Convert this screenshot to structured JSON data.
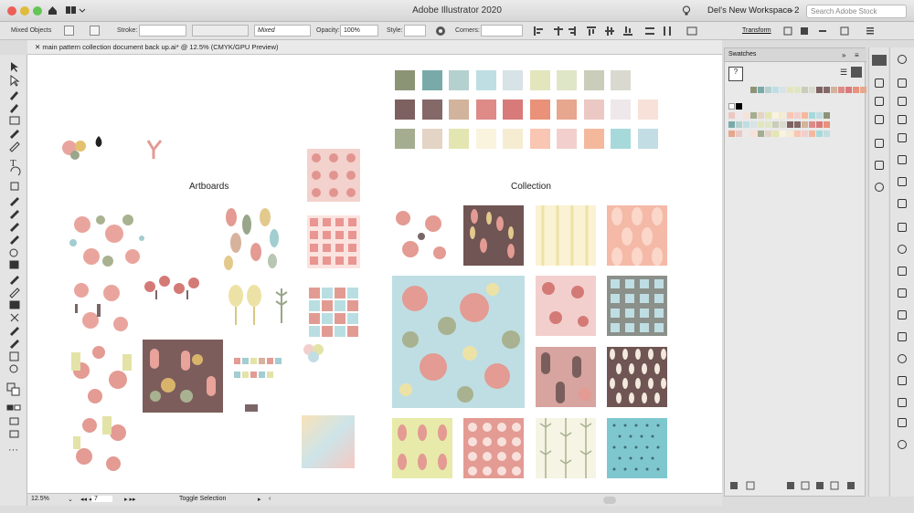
{
  "window": {
    "title": "Adobe Illustrator 2020",
    "workspace": "Del's New Workspace 2",
    "search_placeholder": "Search Adobe Stock"
  },
  "control": {
    "selection": "Mixed Objects",
    "stroke_label": "Stroke:",
    "brush": "Mixed",
    "opacity_label": "Opacity:",
    "opacity": "100%",
    "style_label": "Style:",
    "corners_label": "Corners:",
    "transform": "Transform"
  },
  "document": {
    "tab": "main pattern collection document back up.ai* @ 12.5% (CMYK/GPU Preview)"
  },
  "canvas": {
    "artboards_heading": "Artboards",
    "collection_heading": "Collection"
  },
  "palette": [
    [
      "#8c9476",
      "#79aaa9",
      "#b4d1cf",
      "#bfdee3",
      "#d7e3e6",
      "#e3e6bd",
      "#dfe6c7",
      "#c9cdb9",
      "#d9d9cf"
    ],
    [
      "#7d6161",
      "#856868",
      "#d1b49b",
      "#de8a87",
      "#d97a7a",
      "#e99179",
      "#e7a68e",
      "#ecc8c4",
      "#efe8ea",
      "#f7e1d9"
    ],
    [
      "#a5ad90",
      "#e4d4c5",
      "#e4e6b2",
      "#faf3de",
      "#f6ecd2",
      "#f9c6b3",
      "#f2cfcd",
      "#f4b99c",
      "#a7d9db",
      "#c2dde3"
    ]
  ],
  "statusbar": {
    "zoom": "12.5%",
    "artboard": "7",
    "tool": "Toggle Selection"
  },
  "swatches_panel": {
    "title": "Swatches"
  },
  "colors": {
    "accent": "#3b7bd4",
    "canvas_bg": "#ffffff"
  }
}
